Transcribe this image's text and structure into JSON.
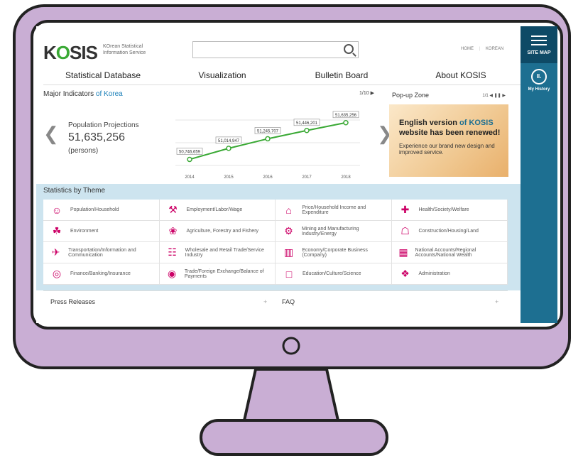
{
  "header": {
    "logo": "KOSIS",
    "logo_subtitle_line1": "KOrean Statistical",
    "logo_subtitle_line2": "Information Service",
    "search_placeholder": "",
    "links": [
      "HOME",
      "KOREAN"
    ]
  },
  "sidebar": {
    "site_map": "SITE MAP",
    "history_icon": "Il.",
    "my_history": "My History"
  },
  "nav": [
    "Statistical Database",
    "Visualization",
    "Bulletin Board",
    "About KOSIS"
  ],
  "indicators": {
    "title_prefix": "Major Indicators",
    "title_highlight": "of Korea",
    "page": "1/10",
    "name": "Population Projections",
    "value": "51,635,256",
    "unit": "(persons)"
  },
  "chart_data": {
    "type": "line",
    "x": [
      "2014",
      "2015",
      "2016",
      "2017",
      "2018"
    ],
    "values": [
      50746659,
      51014947,
      51245707,
      51446201,
      51635256
    ],
    "point_labels": [
      "50,746,659",
      "51,014,947",
      "51,245,707",
      "51,446,201",
      "51,635,256"
    ],
    "title": "",
    "xlabel": "",
    "ylabel": "",
    "color": "#3aa935"
  },
  "popup": {
    "title": "Pop-up Zone",
    "page": "1/1",
    "banner_line1_a": "English version",
    "banner_line1_b": "of KOSIS",
    "banner_line2": "website has been renewed!",
    "banner_line3": "Experience our brand new design and improved service."
  },
  "themes": {
    "title": "Statistics by Theme",
    "items": [
      {
        "label": "Population/Household",
        "icon": "people-icon"
      },
      {
        "label": "Employment/Labor/Wage",
        "icon": "worker-icon"
      },
      {
        "label": "Price/Household Income and Expenditure",
        "icon": "basket-icon"
      },
      {
        "label": "Health/Society/Welfare",
        "icon": "health-icon"
      },
      {
        "label": "Environment",
        "icon": "leaf-icon"
      },
      {
        "label": "Agriculture, Forestry and Fishery",
        "icon": "plant-icon"
      },
      {
        "label": "Mining and Manufacturing Industry/Energy",
        "icon": "factory-icon"
      },
      {
        "label": "Construction/Housing/Land",
        "icon": "house-icon"
      },
      {
        "label": "Transportation/Information and Communication",
        "icon": "car-icon"
      },
      {
        "label": "Wholesale and Retail Trade/Service Industry",
        "icon": "shop-icon"
      },
      {
        "label": "Economy/Corporate Business (Company)",
        "icon": "building-icon"
      },
      {
        "label": "National Accounts/Regional Accounts/National Wealth",
        "icon": "calculator-icon"
      },
      {
        "label": "Finance/Banking/Insurance",
        "icon": "piggybank-icon"
      },
      {
        "label": "Trade/Foreign Exchange/Balance of Payments",
        "icon": "coin-icon"
      },
      {
        "label": "Education/Culture/Science",
        "icon": "book-icon"
      },
      {
        "label": "Administration",
        "icon": "admin-icon"
      }
    ]
  },
  "bottom": {
    "press_releases": "Press Releases",
    "faq": "FAQ",
    "more": "+"
  },
  "colors": {
    "frame": "#c9aed4",
    "sidebar": "#1d6f91",
    "theme_bg": "#cde4ef",
    "accent_green": "#3aa935"
  }
}
